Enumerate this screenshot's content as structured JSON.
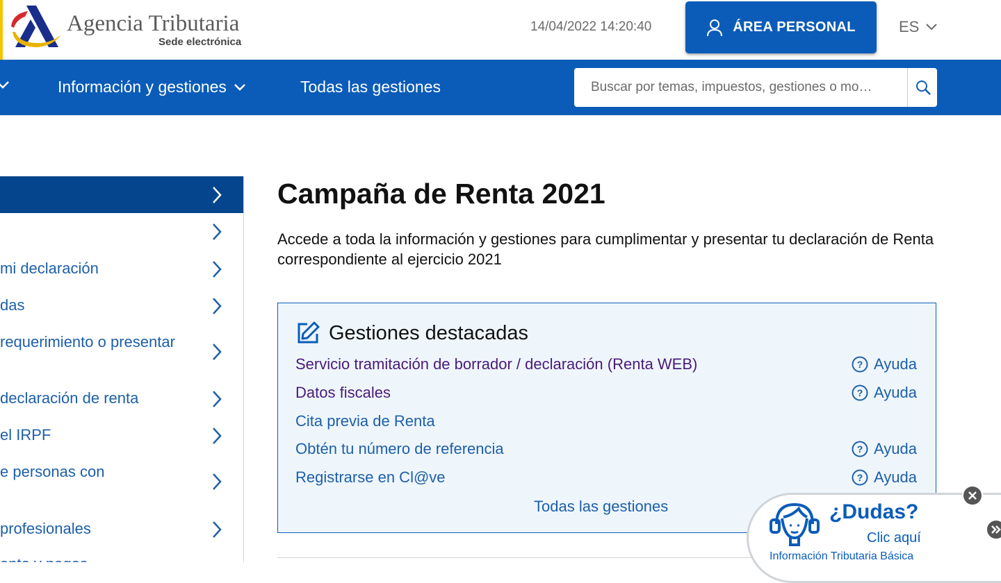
{
  "header": {
    "logo_title": "Agencia Tributaria",
    "logo_subtitle": "Sede electrónica",
    "datetime": "14/04/2022 14:20:40",
    "area_personal_label": "ÁREA PERSONAL",
    "language": "ES"
  },
  "nav": {
    "items": [
      {
        "label": "Información y gestiones"
      },
      {
        "label": "Todas las gestiones"
      }
    ],
    "search_placeholder": "Buscar por temas, impuestos, gestiones o mo…"
  },
  "sidebar": {
    "items": [
      {
        "label": ""
      },
      {
        "label": ""
      },
      {
        "label": "mi declaración"
      },
      {
        "label": "das"
      },
      {
        "label": "requerimiento o presentar"
      },
      {
        "label": "declaración de renta"
      },
      {
        "label": "el IRPF"
      },
      {
        "label": "e personas con"
      },
      {
        "label": "profesionales"
      },
      {
        "label": "ento y pagos"
      }
    ]
  },
  "main": {
    "title": "Campaña de Renta 2021",
    "intro": "Accede a toda la información y gestiones para cumplimentar y presentar tu declaración de Renta correspondiente al ejercicio 2021",
    "card": {
      "title": "Gestiones destacadas",
      "help_label": "Ayuda",
      "links": [
        {
          "label": "Servicio tramitación de borrador / declaración (Renta WEB)"
        },
        {
          "label": "Datos fiscales"
        },
        {
          "label": "Cita previa de Renta"
        },
        {
          "label": "Obtén tu número de referencia"
        },
        {
          "label": "Registrarse en Cl@ve"
        }
      ],
      "all_label": "Todas las gestiones"
    }
  },
  "help_widget": {
    "title": "¿Dudas?",
    "subtitle": "Clic aquí",
    "footer": "Información Tributaria Básica"
  },
  "colors": {
    "brand_blue": "#0b5cb8",
    "active_blue": "#04458d",
    "link_blue": "#1d5fa8",
    "visited_purple": "#4a1a78",
    "card_bg": "#eef6fc",
    "logo_yellow": "#f5c400",
    "help_green": "#8cc63f"
  }
}
